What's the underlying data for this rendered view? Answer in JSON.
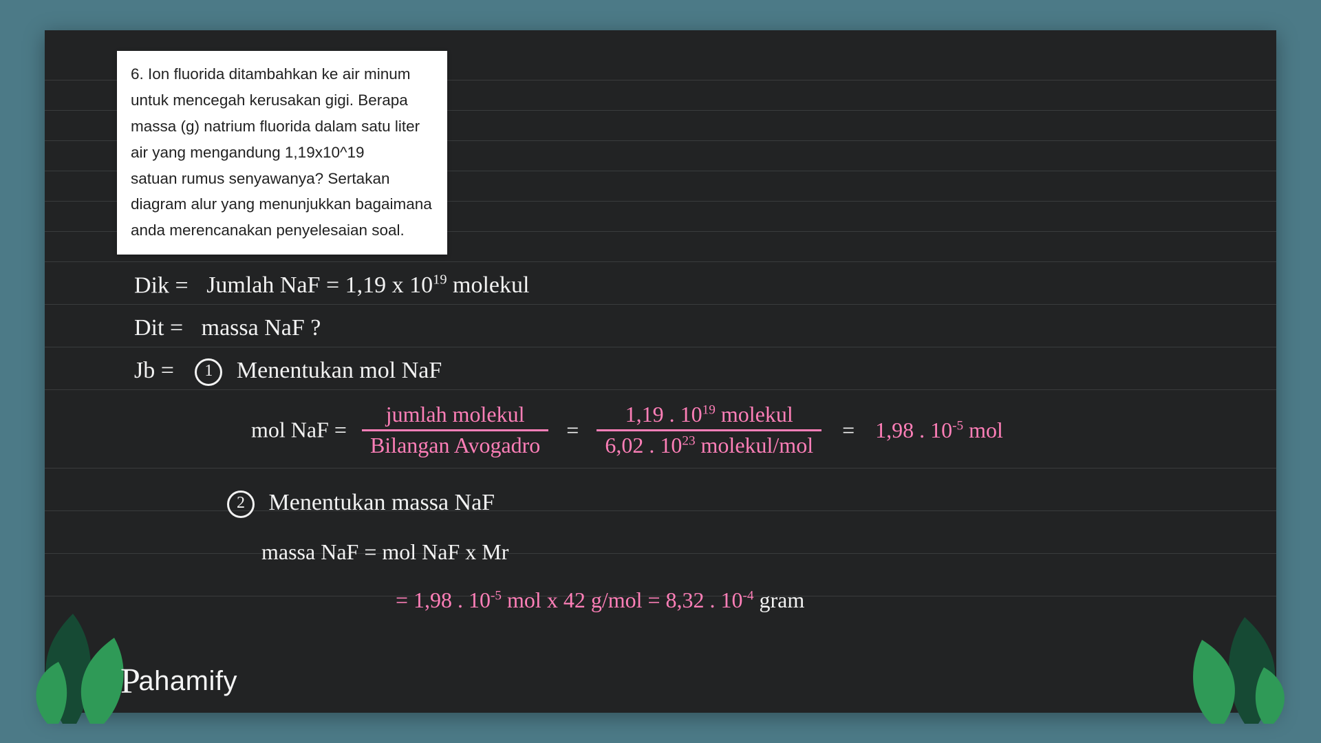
{
  "brand": {
    "name": "Pahamify",
    "initial": "P",
    "rest": "ahamify"
  },
  "question": {
    "lines": [
      "6. Ion fluorida ditambahkan ke air minum",
      "untuk mencegah kerusakan gigi. Berapa",
      "massa (g) natrium fluorida dalam satu liter",
      "air yang mengandung 1,19x10^19",
      "satuan rumus senyawanya? Sertakan",
      "diagram alur yang menunjukkan bagaimana",
      "anda merencanakan penyelesaian soal."
    ]
  },
  "work": {
    "dik_label": "Dik =",
    "dik_text": "Jumlah NaF  =  1,19 x 10",
    "dik_exp": "19",
    "dik_tail": " molekul",
    "dit_label": "Dit =",
    "dit_text": "massa NaF  ?",
    "db_label": "Jb =",
    "step1_num": "1",
    "step1_title": "Menentukan mol NaF",
    "mol_lhs": "mol NaF  =",
    "frac1_num": "jumlah molekul",
    "frac1_den": "Bilangan Avogadro",
    "eq1": "=",
    "frac2_num_a": "1,19 . 10",
    "frac2_num_exp": "19",
    "frac2_num_b": " molekul",
    "frac2_den_a": "6,02 . 10",
    "frac2_den_exp": "23",
    "frac2_den_b": " molekul/mol",
    "eq2": "=",
    "mol_result_a": "1,98 . 10",
    "mol_result_exp": "-5",
    "mol_result_b": " mol",
    "step2_num": "2",
    "step2_title": "Menentukan massa NaF",
    "mass_lhs": "massa NaF  =  mol NaF x Mr",
    "mass_line2_a": "=  1,98 . 10",
    "mass_line2_exp1": "-5",
    "mass_line2_b": " mol  x  42 g/mol  =  8,32 . 10",
    "mass_line2_exp2": "-4",
    "mass_line2_c": "  gram"
  },
  "colors": {
    "bg": "#4c7a87",
    "board": "#222324",
    "rule": "#3a3c3d",
    "pink": "#ff7fb8",
    "white": "#f2f2f2",
    "leaf_dark": "#164a34",
    "leaf_light": "#2f9a57"
  }
}
